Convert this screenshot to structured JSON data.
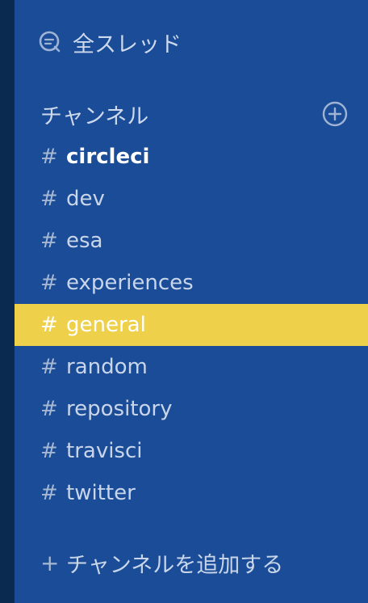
{
  "sidebar": {
    "threads_label": "全スレッド",
    "channels_header": "チャンネル",
    "channels": [
      {
        "name": "circleci",
        "unread": true
      },
      {
        "name": "dev"
      },
      {
        "name": "esa"
      },
      {
        "name": "experiences"
      },
      {
        "name": "general",
        "active": true
      },
      {
        "name": "random"
      },
      {
        "name": "repository"
      },
      {
        "name": "travisci"
      },
      {
        "name": "twitter"
      }
    ],
    "hash_symbol": "#",
    "add_symbol": "+",
    "add_channel_label": "チャンネルを追加する"
  },
  "colors": {
    "sidebar_bg": "#1b4c97",
    "rail_bg": "#0b2a4f",
    "active_bg": "#efd04a",
    "text": "#c9d6ea"
  }
}
